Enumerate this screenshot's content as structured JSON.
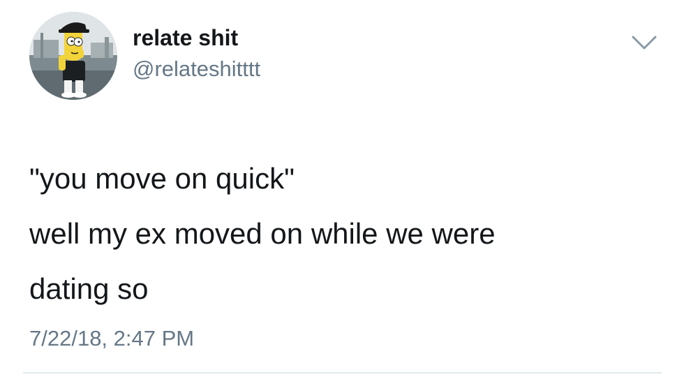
{
  "tweet": {
    "author": {
      "display_name": "relate shit",
      "handle": "@relateshitttt",
      "avatar_icon": "cartoon-character-avatar"
    },
    "text_lines": [
      "\"you move on quick\"",
      "well my ex moved on while we were",
      "dating so"
    ],
    "timestamp": "7/22/18, 2:47 PM",
    "menu_icon": "chevron-down-icon"
  },
  "colors": {
    "background": "#ffffff",
    "primary_text": "#14171a",
    "secondary_text": "#657786",
    "divider": "#e1e8ed"
  }
}
